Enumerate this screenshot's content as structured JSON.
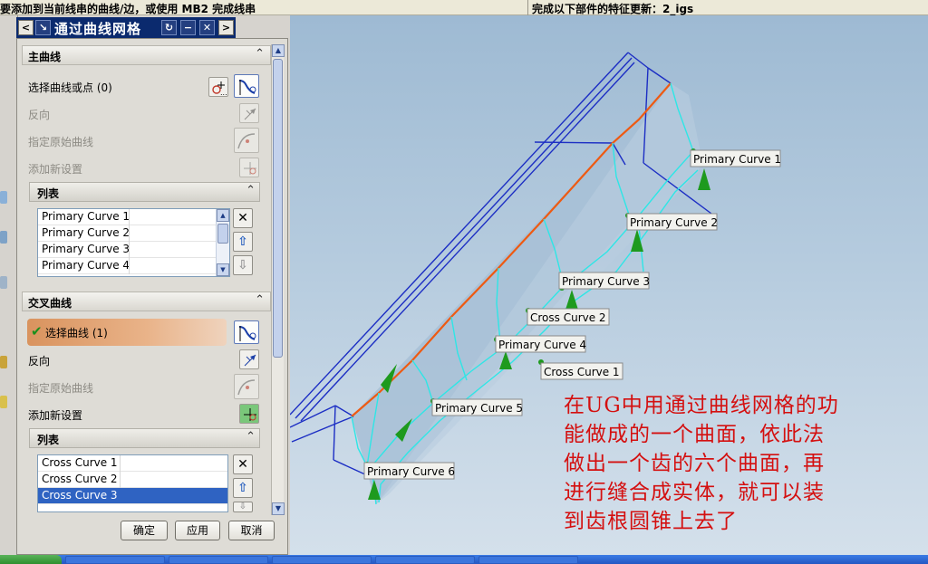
{
  "cue_line": {
    "left_text": "要添加到当前线串的曲线/边，或使用 MB2 完成线串",
    "right_text": "完成以下部件的特征更新：2_igs"
  },
  "dialog": {
    "title": "通过曲线网格",
    "title_buttons": [
      "<",
      "↘",
      "↻",
      "−",
      "✕",
      ">"
    ],
    "primary_section": {
      "title": "主曲线",
      "select_label": "选择曲线或点 (0)",
      "reverse_label": "反向",
      "specify_origin_label": "指定原始曲线",
      "add_new_set_label": "添加新设置",
      "list_title": "列表",
      "items": [
        "Primary Curve  1",
        "Primary Curve  2",
        "Primary Curve  3",
        "Primary Curve  4"
      ]
    },
    "cross_section": {
      "title": "交叉曲线",
      "select_label": "选择曲线 (1)",
      "reverse_label": "反向",
      "specify_origin_label": "指定原始曲线",
      "add_new_set_label": "添加新设置",
      "list_title": "列表",
      "items": [
        "Cross Curve  1",
        "Cross Curve  2",
        "Cross Curve  3"
      ],
      "selected_index": 2
    },
    "buttons": {
      "ok": "确定",
      "apply": "应用",
      "cancel": "取消"
    }
  },
  "viewport": {
    "labels": [
      "Primary Curve  1",
      "Primary Curve  2",
      "Primary Curve  3",
      "Cross Curve  2",
      "Primary Curve  4",
      "Cross Curve  1",
      "Primary Curve  5",
      "Primary Curve  6"
    ],
    "colors": {
      "background_top": "#9ebad3",
      "wireframe": "#1c2ec4",
      "surface_edge": "#2ee6e6",
      "orange_curve": "#ee5a12",
      "cone": "#1e9a1e"
    }
  },
  "annotation": {
    "lines": [
      "在UG中用通过曲线网格的功",
      "能做成的一个曲面，依此法",
      "做出一个齿的六个曲面，再",
      "进行缝合成实体，就可以装",
      "到齿根圆锥上去了"
    ],
    "color": "#d41010"
  }
}
